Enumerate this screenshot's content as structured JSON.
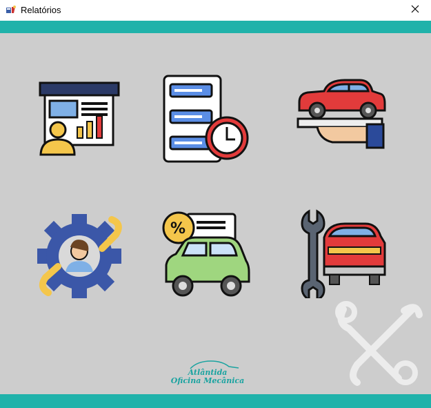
{
  "window": {
    "title": "Relatórios"
  },
  "colors": {
    "accent": "#20b2aa",
    "background": "#cdcdcd",
    "titlebar": "#ffffff"
  },
  "tiles": [
    {
      "name": "report-presentation",
      "icon": "presentation-chart-person-icon"
    },
    {
      "name": "report-schedule",
      "icon": "document-clock-icon"
    },
    {
      "name": "report-car-service",
      "icon": "hand-holding-car-icon"
    },
    {
      "name": "report-employees",
      "icon": "gear-wrench-person-icon"
    },
    {
      "name": "report-discount-sales",
      "icon": "car-percent-document-icon"
    },
    {
      "name": "report-repairs",
      "icon": "wrench-car-icon"
    }
  ],
  "logo": {
    "line1": "Atlântida",
    "line2": "Oficina Mecânica"
  }
}
